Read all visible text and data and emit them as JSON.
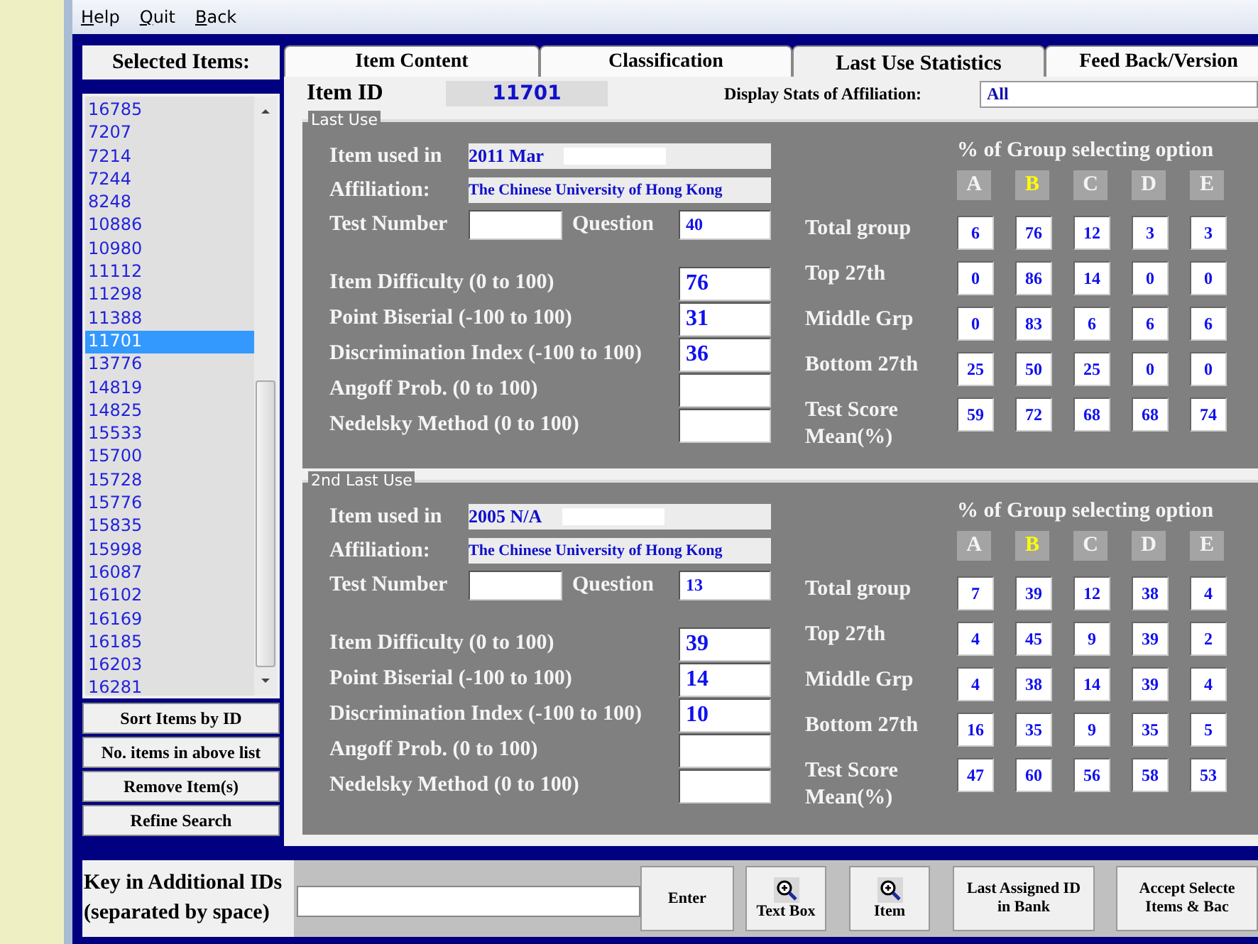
{
  "menu": [
    "Help",
    "Quit",
    "Back"
  ],
  "selected_items": {
    "title": "Selected Items:",
    "items": [
      {
        "label": "16785",
        "selected": false
      },
      {
        "label": "7207",
        "selected": false
      },
      {
        "label": "7214",
        "selected": false
      },
      {
        "label": "7244",
        "selected": false
      },
      {
        "label": "8248",
        "selected": false
      },
      {
        "label": "10886",
        "selected": false
      },
      {
        "label": "10980",
        "selected": false
      },
      {
        "label": "11112",
        "selected": false
      },
      {
        "label": "11298",
        "selected": false
      },
      {
        "label": "11388",
        "selected": false
      },
      {
        "label": "11701",
        "selected": true
      },
      {
        "label": "13776",
        "selected": false
      },
      {
        "label": "14819",
        "selected": false
      },
      {
        "label": "14825",
        "selected": false
      },
      {
        "label": "15533",
        "selected": false
      },
      {
        "label": "15700",
        "selected": false
      },
      {
        "label": "15728",
        "selected": false
      },
      {
        "label": "15776",
        "selected": false
      },
      {
        "label": "15835",
        "selected": false
      },
      {
        "label": "15998",
        "selected": false
      },
      {
        "label": "16087",
        "selected": false
      },
      {
        "label": "16102",
        "selected": false
      },
      {
        "label": "16169",
        "selected": false
      },
      {
        "label": "16185",
        "selected": false
      },
      {
        "label": "16203",
        "selected": false
      },
      {
        "label": "16281",
        "selected": false
      }
    ]
  },
  "side_buttons": [
    "Sort Items by ID",
    "No. items in above list",
    "Remove Item(s)",
    "Refine Search"
  ],
  "tabs": [
    {
      "label": "Item Content",
      "selected": false
    },
    {
      "label": "Classification",
      "selected": false
    },
    {
      "label": "Last Use Statistics",
      "selected": true
    },
    {
      "label": "Feed Back/Version",
      "selected": false
    }
  ],
  "item_id": {
    "label": "Item ID",
    "value": "11701"
  },
  "affiliation_filter": {
    "label": "Display Stats of Affiliation:",
    "value": "All"
  },
  "sections": [
    {
      "legend": "Last Use",
      "used_in": {
        "label": "Item used in",
        "value": "2011  Mar"
      },
      "affiliation": {
        "label": "Affiliation:",
        "value": "The Chinese University of Hong Kong"
      },
      "test_number": {
        "label": "Test Number"
      },
      "question": {
        "label": "Question",
        "value": "40"
      },
      "stats": [
        {
          "label": "Item Difficulty (0 to 100)",
          "value": "76"
        },
        {
          "label": "Point Biserial (-100 to 100)",
          "value": "31"
        },
        {
          "label": "Discrimination Index (-100 to 100)",
          "value": "36"
        },
        {
          "label": "Angoff Prob. (0 to 100)"
        },
        {
          "label": "Nedelsky Method (0 to 100)"
        }
      ],
      "options_title": "% of Group selecting option",
      "options": [
        {
          "label": "A",
          "key": false
        },
        {
          "label": "B",
          "key": true
        },
        {
          "label": "C",
          "key": false
        },
        {
          "label": "D",
          "key": false
        },
        {
          "label": "E",
          "key": false
        }
      ],
      "groups": [
        {
          "label": "Total group",
          "values": [
            "6",
            "76",
            "12",
            "3",
            "3"
          ]
        },
        {
          "label": "Top 27th",
          "values": [
            "0",
            "86",
            "14",
            "0",
            "0"
          ]
        },
        {
          "label": "Middle Grp",
          "values": [
            "0",
            "83",
            "6",
            "6",
            "6"
          ]
        },
        {
          "label": "Bottom 27th",
          "values": [
            "25",
            "50",
            "25",
            "0",
            "0"
          ]
        },
        {
          "label": "Test Score Mean(%)",
          "values": [
            "59",
            "72",
            "68",
            "68",
            "74"
          ]
        }
      ]
    },
    {
      "legend": "2nd Last Use",
      "used_in": {
        "label": "Item used in",
        "value": "2005  N/A"
      },
      "affiliation": {
        "label": "Affiliation:",
        "value": "The Chinese University of Hong Kong"
      },
      "test_number": {
        "label": "Test Number"
      },
      "question": {
        "label": "Question",
        "value": "13"
      },
      "stats": [
        {
          "label": "Item Difficulty (0 to 100)",
          "value": "39"
        },
        {
          "label": "Point Biserial (-100 to 100)",
          "value": "14"
        },
        {
          "label": "Discrimination Index (-100 to 100)",
          "value": "10"
        },
        {
          "label": "Angoff Prob. (0 to 100)"
        },
        {
          "label": "Nedelsky Method (0 to 100)"
        }
      ],
      "options_title": "% of Group selecting option",
      "options": [
        {
          "label": "A",
          "key": false
        },
        {
          "label": "B",
          "key": true
        },
        {
          "label": "C",
          "key": false
        },
        {
          "label": "D",
          "key": false
        },
        {
          "label": "E",
          "key": false
        }
      ],
      "groups": [
        {
          "label": "Total group",
          "values": [
            "7",
            "39",
            "12",
            "38",
            "4"
          ]
        },
        {
          "label": "Top 27th",
          "values": [
            "4",
            "45",
            "9",
            "39",
            "2"
          ]
        },
        {
          "label": "Middle Grp",
          "values": [
            "4",
            "38",
            "14",
            "39",
            "4"
          ]
        },
        {
          "label": "Bottom 27th",
          "values": [
            "16",
            "35",
            "9",
            "35",
            "5"
          ]
        },
        {
          "label": "Test Score Mean(%)",
          "values": [
            "47",
            "60",
            "56",
            "58",
            "53"
          ]
        }
      ]
    }
  ],
  "bottom": {
    "label_lines": [
      "Key in Additional IDs",
      "(separated by space)"
    ],
    "buttons": [
      {
        "kind": "text",
        "lines": [
          "Enter"
        ]
      },
      {
        "kind": "zoom",
        "lines": [
          "Text Box"
        ]
      },
      {
        "kind": "zoom",
        "lines": [
          "Item"
        ]
      },
      {
        "kind": "text",
        "lines": [
          "Last Assigned ID",
          "in Bank"
        ]
      },
      {
        "kind": "text",
        "lines": [
          "Accept Selecte",
          "Items & Bac"
        ]
      }
    ]
  }
}
